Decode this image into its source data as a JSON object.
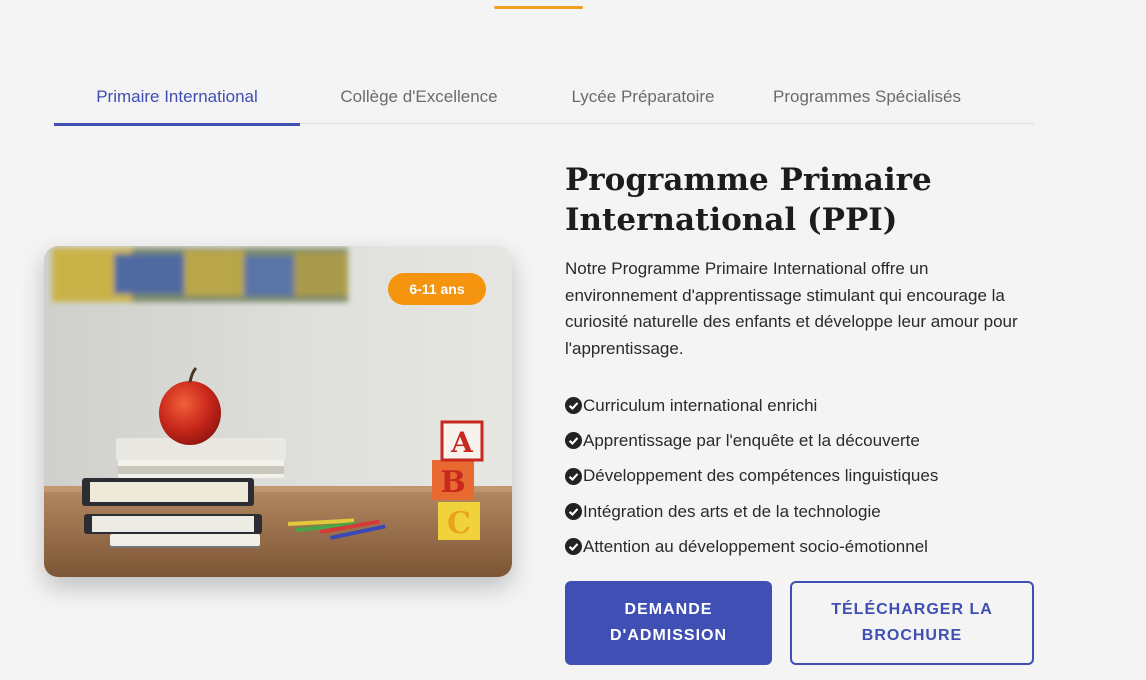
{
  "tabs": [
    {
      "label": "Primaire International",
      "active": true
    },
    {
      "label": "Collège d'Excellence",
      "active": false
    },
    {
      "label": "Lycée Préparatoire",
      "active": false
    },
    {
      "label": "Programmes Spécialisés",
      "active": false
    }
  ],
  "program": {
    "age_badge": "6-11 ans",
    "title": "Programme Primaire International (PPI)",
    "description": "Notre Programme Primaire International offre un environnement d'apprentissage stimulant qui encourage la curiosité naturelle des enfants et développe leur amour pour l'apprentissage.",
    "features": [
      "Curriculum international enrichi",
      "Apprentissage par l'enquête et la découverte",
      "Développement des compétences linguistiques",
      "Intégration des arts et de la technologie",
      "Attention au développement socio-émotionnel"
    ],
    "primary_button": "Demande d'admission",
    "secondary_button": "Télécharger la brochure"
  },
  "colors": {
    "accent": "#3f4fb3",
    "badge": "#f5950f",
    "top_bar": "#f0a020"
  },
  "icons": {
    "feature_bullet": "check-circle-icon"
  }
}
